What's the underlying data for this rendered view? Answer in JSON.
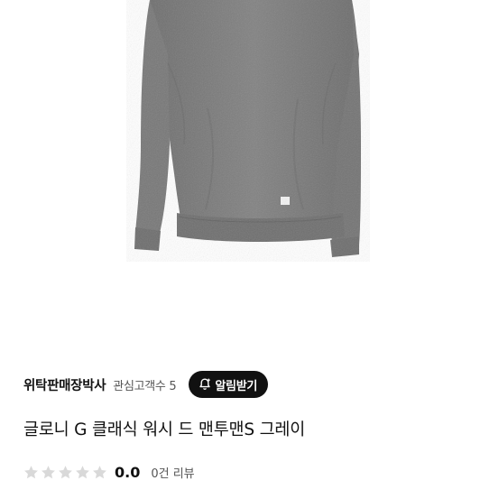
{
  "product": {
    "image_icon": "gray-washed-sweatshirt",
    "title": "글로니 G 클래식 워시 드 맨투맨S 그레이"
  },
  "seller": {
    "name": "위탁판매장박사",
    "followers_label": "관심고객수 5",
    "alert_button_label": "알림받기"
  },
  "rating": {
    "stars_total": 5,
    "stars_filled": 0,
    "value": "0.0",
    "reviews_label": "0건 리뷰"
  },
  "colors": {
    "sweatshirt": "#7b7b7b",
    "button_bg": "#111111",
    "star_empty": "#d9d9d9"
  }
}
